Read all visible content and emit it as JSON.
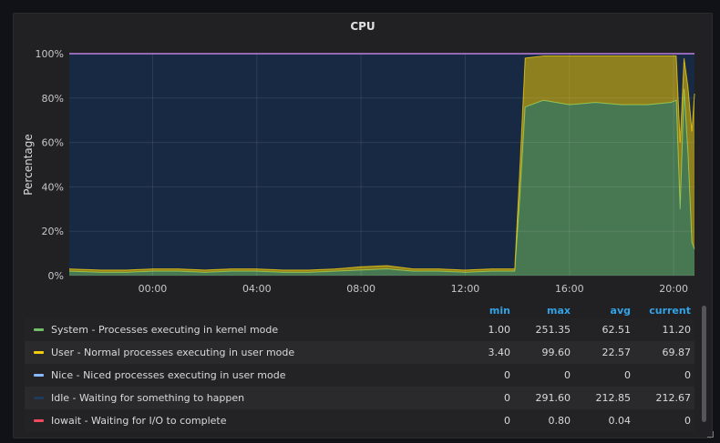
{
  "panel": {
    "title": "CPU"
  },
  "chart_data": {
    "type": "area",
    "title": "CPU",
    "ylabel": "Percentage",
    "xlabel": "",
    "ylim": [
      0,
      100
    ],
    "y_ticks": [
      "0%",
      "20%",
      "40%",
      "60%",
      "80%",
      "100%"
    ],
    "y_tick_values": [
      0,
      20,
      40,
      60,
      80,
      100
    ],
    "x_ticks": [
      "00:00",
      "04:00",
      "08:00",
      "12:00",
      "16:00",
      "20:00"
    ],
    "x_tick_values": [
      0,
      4,
      8,
      12,
      16,
      20
    ],
    "xlim": [
      -3.2,
      20.8
    ],
    "stacked": true,
    "grid": true,
    "background": "#152236",
    "x": [
      -3.2,
      -2,
      -1,
      0,
      1,
      2,
      3,
      4,
      5,
      6,
      7,
      8,
      9,
      10,
      11,
      12,
      13,
      13.9,
      14.1,
      14.3,
      15,
      16,
      17,
      18,
      19,
      19.9,
      20.1,
      20.25,
      20.4,
      20.55,
      20.7,
      20.8
    ],
    "series": [
      {
        "name": "System - Processes executing in kernel mode",
        "color": "#73bf69",
        "values": [
          2,
          1.5,
          1.5,
          2,
          2,
          1.5,
          2,
          2,
          1.5,
          1.5,
          2,
          2.5,
          3,
          2,
          2,
          1.5,
          2,
          2,
          36,
          76,
          79,
          77,
          78,
          77,
          77,
          78,
          79,
          30,
          84,
          55,
          15,
          12
        ]
      },
      {
        "name": "User - Normal processes executing in user mode",
        "color": "#f2cc0c",
        "values": [
          1,
          1,
          1,
          1,
          1,
          1,
          1,
          1,
          1,
          1,
          1,
          1.5,
          1.5,
          1,
          1,
          1,
          1,
          1,
          13,
          22,
          20,
          22,
          21,
          22,
          22,
          21,
          20,
          30,
          14,
          30,
          50,
          70
        ]
      },
      {
        "name": "Nice - Niced processes executing in user mode",
        "color": "#8ab8ff",
        "values": [
          0,
          0,
          0,
          0,
          0,
          0,
          0,
          0,
          0,
          0,
          0,
          0,
          0,
          0,
          0,
          0,
          0,
          0,
          0,
          0,
          0,
          0,
          0,
          0,
          0,
          0,
          0,
          0,
          0,
          0,
          0,
          0
        ]
      },
      {
        "name": "Idle - Waiting for something to happen",
        "color": "#1f3a5c",
        "values": [
          97,
          97.5,
          97.5,
          97,
          97,
          97.5,
          97,
          97,
          97.5,
          97.5,
          97,
          96,
          95.5,
          97,
          97,
          97.5,
          97,
          97,
          51,
          2,
          1,
          1,
          1,
          1,
          1,
          1,
          1,
          40,
          2,
          15,
          35,
          18
        ]
      },
      {
        "name": "Iowait - Waiting for I/O to complete",
        "color": "#f2495c",
        "values": [
          0,
          0,
          0,
          0,
          0,
          0,
          0,
          0,
          0,
          0,
          0,
          0,
          0,
          0,
          0,
          0,
          0,
          0,
          0,
          0,
          0,
          0,
          0,
          0,
          0,
          0,
          0,
          0,
          0,
          0,
          0,
          0
        ]
      }
    ]
  },
  "legend": {
    "columns": [
      "min",
      "max",
      "avg",
      "current"
    ],
    "rows": [
      {
        "name": "System - Processes executing in kernel mode",
        "color": "#73bf69",
        "min": "1.00",
        "max": "251.35",
        "avg": "62.51",
        "current": "11.20"
      },
      {
        "name": "User - Normal processes executing in user mode",
        "color": "#f2cc0c",
        "min": "3.40",
        "max": "99.60",
        "avg": "22.57",
        "current": "69.87"
      },
      {
        "name": "Nice - Niced processes executing in user mode",
        "color": "#8ab8ff",
        "min": "0",
        "max": "0",
        "avg": "0",
        "current": "0"
      },
      {
        "name": "Idle - Waiting for something to happen",
        "color": "#1f3a5c",
        "min": "0",
        "max": "291.60",
        "avg": "212.85",
        "current": "212.67"
      },
      {
        "name": "Iowait - Waiting for I/O to complete",
        "color": "#f2495c",
        "min": "0",
        "max": "0.80",
        "avg": "0.04",
        "current": "0"
      }
    ]
  }
}
